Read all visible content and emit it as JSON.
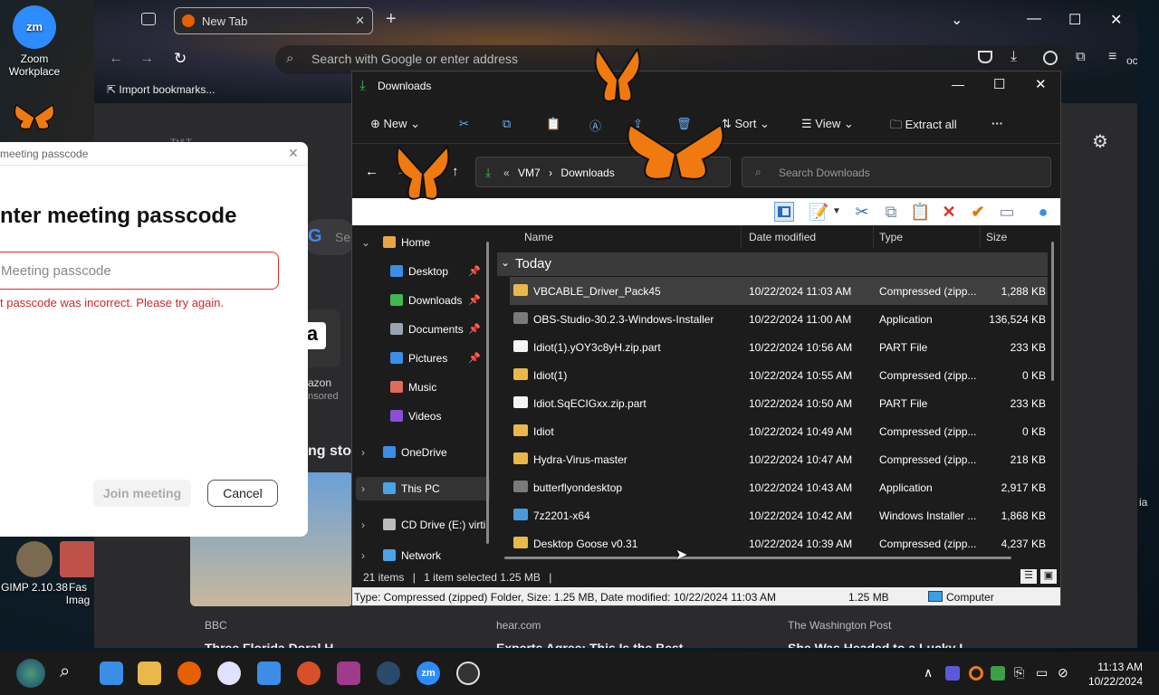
{
  "desktop": {
    "icons": [
      {
        "label": "Zoom\nWorkplace",
        "line1": "Zoom",
        "line2": "Workplace"
      },
      {
        "label": "GIMP 2.10.38"
      },
      {
        "label": "Fas Imag",
        "line1": "Fas",
        "line2": "Imag"
      }
    ],
    "right_edge_text": "ia"
  },
  "browser": {
    "tab_title": "New Tab",
    "address_placeholder": "Search with Google or enter address",
    "bookmarks_label": "Import bookmarks...",
    "right_fragment": "ocs",
    "partial_texts": {
      "top": "Tt&T",
      "search_fragment": "Se",
      "amazon_line1": "azon",
      "amazon_line2": "nsored",
      "stories": "ng sto",
      "news1_source": "BBC",
      "news1_title": "Three Florida Doral H...",
      "news2_source": "hear.com",
      "news2_title": "Experts Agree: This Is the Best...",
      "news3_source": "The Washington Post",
      "news3_title": "She Was Headed to a Lucky L..."
    }
  },
  "zoom_dialog": {
    "title": "meeting passcode",
    "heading": "nter meeting passcode",
    "input_placeholder": "Meeting passcode",
    "error": "t passcode was incorrect. Please try again.",
    "join_label": "Join meeting",
    "cancel_label": "Cancel"
  },
  "explorer": {
    "title": "Downloads",
    "toolbar": {
      "new_label": "New",
      "sort_label": "Sort",
      "view_label": "View",
      "extract_label": "Extract all",
      "more": "···"
    },
    "breadcrumb": {
      "overflow": "«",
      "parent": "VM7",
      "sep": "›",
      "current": "Downloads"
    },
    "search_placeholder": "Search Downloads",
    "sidebar": [
      {
        "label": "Home",
        "icon": "home-icon",
        "color": "#e8a44a",
        "pinned": false
      },
      {
        "label": "Desktop",
        "icon": "desktop-icon",
        "color": "#3a8ee6",
        "pinned": true
      },
      {
        "label": "Downloads",
        "icon": "download-icon",
        "color": "#3fb950",
        "pinned": true
      },
      {
        "label": "Documents",
        "icon": "document-icon",
        "color": "#9aa4b0",
        "pinned": true
      },
      {
        "label": "Pictures",
        "icon": "picture-icon",
        "color": "#3a8ee6",
        "pinned": true
      },
      {
        "label": "Music",
        "icon": "music-icon",
        "color": "#e06b5a",
        "pinned": false
      },
      {
        "label": "Videos",
        "icon": "video-icon",
        "color": "#8a4fd8",
        "pinned": false
      },
      {
        "label": "OneDrive",
        "icon": "cloud-icon",
        "color": "#3a8ee6",
        "pinned": false
      },
      {
        "label": "This PC",
        "icon": "pc-icon",
        "color": "#4aa3e6",
        "pinned": false
      },
      {
        "label": "CD Drive (E:) virti",
        "icon": "cd-drive-icon",
        "color": "#bbbbbb",
        "pinned": false
      },
      {
        "label": "Network",
        "icon": "network-icon",
        "color": "#4aa3e6",
        "pinned": false
      }
    ],
    "columns": [
      "Name",
      "Date modified",
      "Type",
      "Size"
    ],
    "group_label": "Today",
    "files": [
      {
        "name": "VBCABLE_Driver_Pack45",
        "date": "10/22/2024 11:03 AM",
        "type": "Compressed (zipp...",
        "size": "1,288 KB",
        "icon": "zip-folder-icon",
        "selected": true
      },
      {
        "name": "OBS-Studio-30.2.3-Windows-Installer",
        "date": "10/22/2024 11:00 AM",
        "type": "Application",
        "size": "136,524 KB",
        "icon": "app-icon",
        "selected": false
      },
      {
        "name": "Idiot(1).yOY3c8yH.zip.part",
        "date": "10/22/2024 10:56 AM",
        "type": "PART File",
        "size": "233 KB",
        "icon": "file-icon",
        "selected": false
      },
      {
        "name": "Idiot(1)",
        "date": "10/22/2024 10:55 AM",
        "type": "Compressed (zipp...",
        "size": "0 KB",
        "icon": "zip-folder-icon",
        "selected": false
      },
      {
        "name": "Idiot.SqECIGxx.zip.part",
        "date": "10/22/2024 10:50 AM",
        "type": "PART File",
        "size": "233 KB",
        "icon": "file-icon",
        "selected": false
      },
      {
        "name": "Idiot",
        "date": "10/22/2024 10:49 AM",
        "type": "Compressed (zipp...",
        "size": "0 KB",
        "icon": "zip-folder-icon",
        "selected": false
      },
      {
        "name": "Hydra-Virus-master",
        "date": "10/22/2024 10:47 AM",
        "type": "Compressed (zipp...",
        "size": "218 KB",
        "icon": "zip-folder-icon",
        "selected": false
      },
      {
        "name": "butterflyondesktop",
        "date": "10/22/2024 10:43 AM",
        "type": "Application",
        "size": "2,917 KB",
        "icon": "app-icon",
        "selected": false
      },
      {
        "name": "7z2201-x64",
        "date": "10/22/2024 10:42 AM",
        "type": "Windows Installer ...",
        "size": "1,868 KB",
        "icon": "installer-icon",
        "selected": false
      },
      {
        "name": "Desktop Goose v0.31",
        "date": "10/22/2024 10:39 AM",
        "type": "Compressed (zipp...",
        "size": "4,237 KB",
        "icon": "zip-folder-icon",
        "selected": false
      }
    ],
    "status": {
      "count": "21 items",
      "selected": "1 item selected  1.25 MB"
    },
    "classic_status": {
      "details": "Type: Compressed (zipped) Folder, Size: 1.25 MB, Date modified: 10/22/2024 11:03 AM",
      "size": "1.25 MB",
      "location": "Computer"
    }
  },
  "taskbar": {
    "time": "11:13 AM",
    "date": "10/22/2024",
    "apps": [
      "start-icon",
      "search-icon",
      "task-view-icon",
      "file-explorer-icon",
      "firefox-icon",
      "itunes-icon",
      "store-icon",
      "app-icon",
      "winrar-icon",
      "steam-icon",
      "zoom-icon",
      "obs-icon"
    ],
    "zoom_label": "zm"
  },
  "colors": {
    "zip_folder": "#e8b84a",
    "accent_green": "#3fb950",
    "error_red": "#d0262a"
  }
}
